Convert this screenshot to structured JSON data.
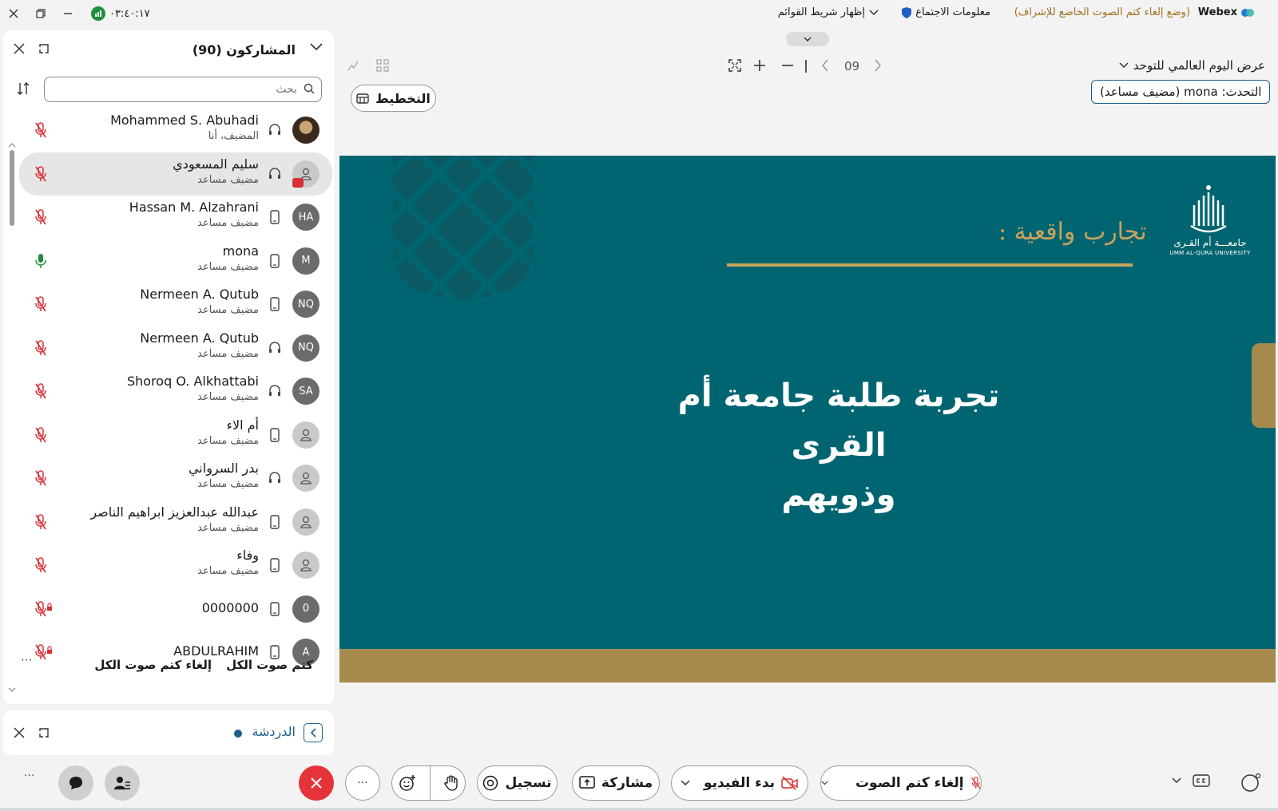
{
  "topbar": {
    "app_name": "Webex",
    "mute_mode": "(وضع إلغاء كتم الصوت الخاضع للإشراف)",
    "meeting_info": "معلومات الاجتماع",
    "show_menu_bar": "إظهار شريط القوائم",
    "timer": "٠٣:٤٠:١٧"
  },
  "participants": {
    "title": "المشاركون (90)",
    "search_placeholder": "بحث",
    "list": [
      {
        "name": "Mohammed S. Abuhadi",
        "role": "المضيف، أنا",
        "avatar": "",
        "device": "headset-icon",
        "mic": "muted"
      },
      {
        "name": "سليم المسعودي",
        "role": "مضيف مساعد",
        "avatar": "",
        "device": "headset-icon",
        "mic": "muted"
      },
      {
        "name": "Hassan M. Alzahrani",
        "role": "مضيف مساعد",
        "avatar": "HA",
        "device": "phone-icon",
        "mic": "muted"
      },
      {
        "name": "mona",
        "role": "مضيف مساعد",
        "avatar": "M",
        "device": "phone-icon",
        "mic": "active"
      },
      {
        "name": "Nermeen A. Qutub",
        "role": "مضيف مساعد",
        "avatar": "NQ",
        "device": "phone-icon",
        "mic": "muted"
      },
      {
        "name": "Nermeen A. Qutub",
        "role": "مضيف مساعد",
        "avatar": "NQ",
        "device": "headset-icon",
        "mic": "muted"
      },
      {
        "name": "Shoroq O. Alkhattabi",
        "role": "مضيف مساعد",
        "avatar": "SA",
        "device": "headset-icon",
        "mic": "muted"
      },
      {
        "name": "أم الاء",
        "role": "مضيف مساعد",
        "avatar": "",
        "device": "phone-icon",
        "mic": "muted"
      },
      {
        "name": "بدر السرواني",
        "role": "مضيف مساعد",
        "avatar": "",
        "device": "headset-icon",
        "mic": "muted"
      },
      {
        "name": "عبدالله عبدالعزيز ابراهيم الناصر",
        "role": "مضيف مساعد",
        "avatar": "",
        "device": "phone-icon",
        "mic": "muted"
      },
      {
        "name": "وفاء",
        "role": "مضيف مساعد",
        "avatar": "",
        "device": "phone-icon",
        "mic": "muted"
      },
      {
        "name": "0000000",
        "role": "",
        "avatar": "0",
        "device": "phone-icon",
        "mic": "muted-lock"
      },
      {
        "name": "ABDULRAHIM",
        "role": "",
        "avatar": "A",
        "device": "phone-icon",
        "mic": "muted-lock"
      }
    ],
    "mute_all": "كتم صوت الكل",
    "unmute_all": "إلغاء كتم صوت الكل",
    "more": "···"
  },
  "chat": {
    "title": "الدردشة"
  },
  "content": {
    "share_title": "عرض اليوم العالمي للتوحد",
    "page_number": "09",
    "speaker_label": "التحدث:",
    "speaker_name": "mona (مضيف مساعد)",
    "layout_label": "التخطيط"
  },
  "slide": {
    "subtitle": "تجارب واقعية :",
    "title_line1": "تجربة طلبة جامعة أم القرى",
    "title_line2": "وذويهم",
    "logo_ar": "جامعـــة أم القـرى",
    "logo_en": "UMM AL-QURA UNIVERSITY"
  },
  "toolbar": {
    "unmute": "إلغاء كتم الصوت",
    "start_video": "بدء الفيديو",
    "share": "مشاركة",
    "record": "تسجيل",
    "more": "···",
    "side_more": "···"
  },
  "colors": {
    "slide_bg": "#006571",
    "slide_gold": "#a68a4d",
    "leave_red": "#e5333a",
    "accent_blue": "#1b5f8c"
  }
}
